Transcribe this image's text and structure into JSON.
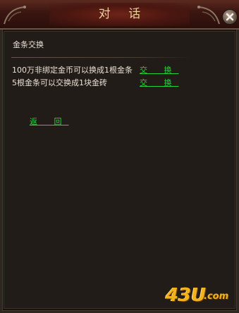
{
  "dialog": {
    "title": "对 话",
    "section_title": "金条交换",
    "offers": [
      {
        "text": "100万非绑定金币可以换成1根金条",
        "action": "交 换"
      },
      {
        "text": "5根金条可以交换成1块金砖",
        "action": "交 换"
      }
    ],
    "back_label": "返 回"
  },
  "watermark": {
    "main": "43U",
    "suffix": ".com"
  },
  "colors": {
    "title_bar": "#3d1611",
    "title_text": "#e9d19b",
    "panel_bg": "#221c19",
    "body_text": "#e8e1d6",
    "link": "#25d23a",
    "watermark": "#f3b21a"
  },
  "icons": {
    "close": "close-icon",
    "corner": "ornament-icon"
  }
}
